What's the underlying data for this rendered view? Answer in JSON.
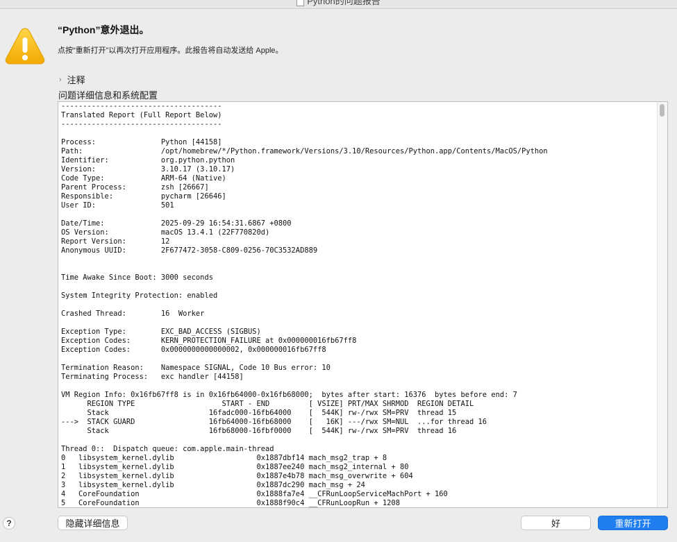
{
  "window": {
    "title": "Python的问题报告"
  },
  "alert": {
    "title": "“Python”意外退出。",
    "message": "点按“重新打开”以再次打开应用程序。此报告将自动发送给 Apple。"
  },
  "notes": {
    "label": "注释"
  },
  "details": {
    "title": "问题详细信息和系统配置",
    "report_lines": [
      "-------------------------------------",
      "Translated Report (Full Report Below)",
      "-------------------------------------",
      "",
      "Process:               Python [44158]",
      "Path:                  /opt/homebrew/*/Python.framework/Versions/3.10/Resources/Python.app/Contents/MacOS/Python",
      "Identifier:            org.python.python",
      "Version:               3.10.17 (3.10.17)",
      "Code Type:             ARM-64 (Native)",
      "Parent Process:        zsh [26667]",
      "Responsible:           pycharm [26646]",
      "User ID:               501",
      "",
      "Date/Time:             2025-09-29 16:54:31.6867 +0800",
      "OS Version:            macOS 13.4.1 (22F770820d)",
      "Report Version:        12",
      "Anonymous UUID:        2F677472-3058-C809-0256-70C3532AD889",
      "",
      "",
      "Time Awake Since Boot: 3000 seconds",
      "",
      "System Integrity Protection: enabled",
      "",
      "Crashed Thread:        16  Worker",
      "",
      "Exception Type:        EXC_BAD_ACCESS (SIGBUS)",
      "Exception Codes:       KERN_PROTECTION_FAILURE at 0x000000016fb67ff8",
      "Exception Codes:       0x0000000000000002, 0x000000016fb67ff8",
      "",
      "Termination Reason:    Namespace SIGNAL, Code 10 Bus error: 10",
      "Terminating Process:   exc handler [44158]",
      "",
      "VM Region Info: 0x16fb67ff8 is in 0x16fb64000-0x16fb68000;  bytes after start: 16376  bytes before end: 7",
      "      REGION TYPE                    START - END         [ VSIZE] PRT/MAX SHRMOD  REGION DETAIL",
      "      Stack                       16fadc000-16fb64000    [  544K] rw-/rwx SM=PRV  thread 15",
      "--->  STACK GUARD                 16fb64000-16fb68000    [   16K] ---/rwx SM=NUL  ...for thread 16",
      "      Stack                       16fb68000-16fbf0000    [  544K] rw-/rwx SM=PRV  thread 16",
      "",
      "Thread 0::  Dispatch queue: com.apple.main-thread",
      "0   libsystem_kernel.dylib                   0x1887dbf14 mach_msg2_trap + 8",
      "1   libsystem_kernel.dylib                   0x1887ee240 mach_msg2_internal + 80",
      "2   libsystem_kernel.dylib                   0x1887e4b78 mach_msg_overwrite + 604",
      "3   libsystem_kernel.dylib                   0x1887dc290 mach_msg + 24",
      "4   CoreFoundation                           0x1888fa7e4 __CFRunLoopServiceMachPort + 160",
      "5   CoreFoundation                           0x1888f90c4 __CFRunLoopRun + 1208"
    ]
  },
  "buttons": {
    "help": "?",
    "hide_details": "隐藏详细信息",
    "ok": "好",
    "reopen": "重新打开"
  },
  "colors": {
    "accent": "#1f7ef0",
    "warning": "#f5b500"
  },
  "icons": {
    "warning": "warning-triangle-icon",
    "chevron": "chevron-right-icon",
    "document": "document-icon"
  }
}
